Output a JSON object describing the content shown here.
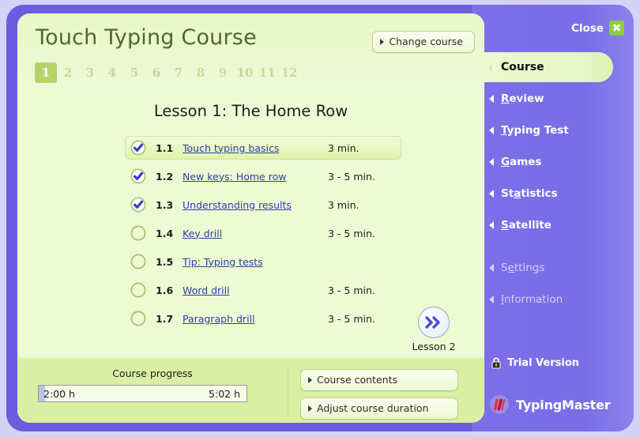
{
  "header": {
    "title": "Touch Typing Course",
    "change_course_label": "Change course",
    "lesson_numbers": [
      "1",
      "2",
      "3",
      "4",
      "5",
      "6",
      "7",
      "8",
      "9",
      "10",
      "11",
      "12"
    ],
    "active_lesson_number": "1"
  },
  "lesson": {
    "heading": "Lesson 1: The Home Row",
    "items": [
      {
        "code": "1.1",
        "title": "Touch typing basics",
        "time": "3 min.",
        "done": true,
        "selected": true
      },
      {
        "code": "1.2",
        "title": "New keys: Home row ",
        "time": "3 - 5 min.",
        "done": true,
        "selected": false
      },
      {
        "code": "1.3",
        "title": "Understanding results",
        "time": "3 min.",
        "done": true,
        "selected": false
      },
      {
        "code": "1.4",
        "title": "Key drill",
        "time": "3 - 5 min.",
        "done": false,
        "selected": false
      },
      {
        "code": "1.5",
        "title": "Tip: Typing tests",
        "time": "",
        "done": false,
        "selected": false
      },
      {
        "code": "1.6",
        "title": "Word drill",
        "time": "3 - 5 min.",
        "done": false,
        "selected": false
      },
      {
        "code": "1.7",
        "title": "Paragraph drill",
        "time": "3 - 5 min.",
        "done": false,
        "selected": false
      }
    ],
    "next_label": "Lesson 2",
    "next_icon": "double-chevron-right-icon"
  },
  "footer": {
    "progress_label": "Course progress",
    "progress_start": "2:00 h",
    "progress_end": "5:02 h",
    "buttons": [
      {
        "label": "Course contents"
      },
      {
        "label": "Adjust course duration"
      }
    ]
  },
  "sidebar": {
    "close_label": "Close",
    "close_icon": "close-x-icon",
    "active_item": {
      "label": "Course",
      "icon": "chevron-left-icon"
    },
    "items": [
      {
        "accel": "R",
        "rest": "eview",
        "dim": false
      },
      {
        "accel": "T",
        "rest": "yping Test",
        "dim": false
      },
      {
        "accel": "G",
        "rest": "ames",
        "dim": false
      },
      {
        "accel": "S",
        "rest": "tatistics",
        "dim": false
      },
      {
        "accel": "S",
        "rest": "atellite",
        "dim": false
      },
      {
        "accel": "e",
        "rest": "ttings",
        "dim": true,
        "prefix": "S"
      },
      {
        "accel": "I",
        "rest": "nformation",
        "dim": true
      }
    ],
    "trial_label": "Trial Version",
    "trial_icon": "lock-icon",
    "brand_name": "TypingMaster",
    "brand_icon": "typingmaster-logo-icon"
  },
  "colors": {
    "frame_purple": "#6c5ce0",
    "sidebar_purple": "#7a6de7",
    "panel_green": "#eefad4",
    "footer_green": "#d9f0a4",
    "active_number_green": "#b5d36b",
    "link_blue": "#2c3fa8",
    "close_green": "#8ccf3f",
    "brand_red": "#e8334a"
  }
}
